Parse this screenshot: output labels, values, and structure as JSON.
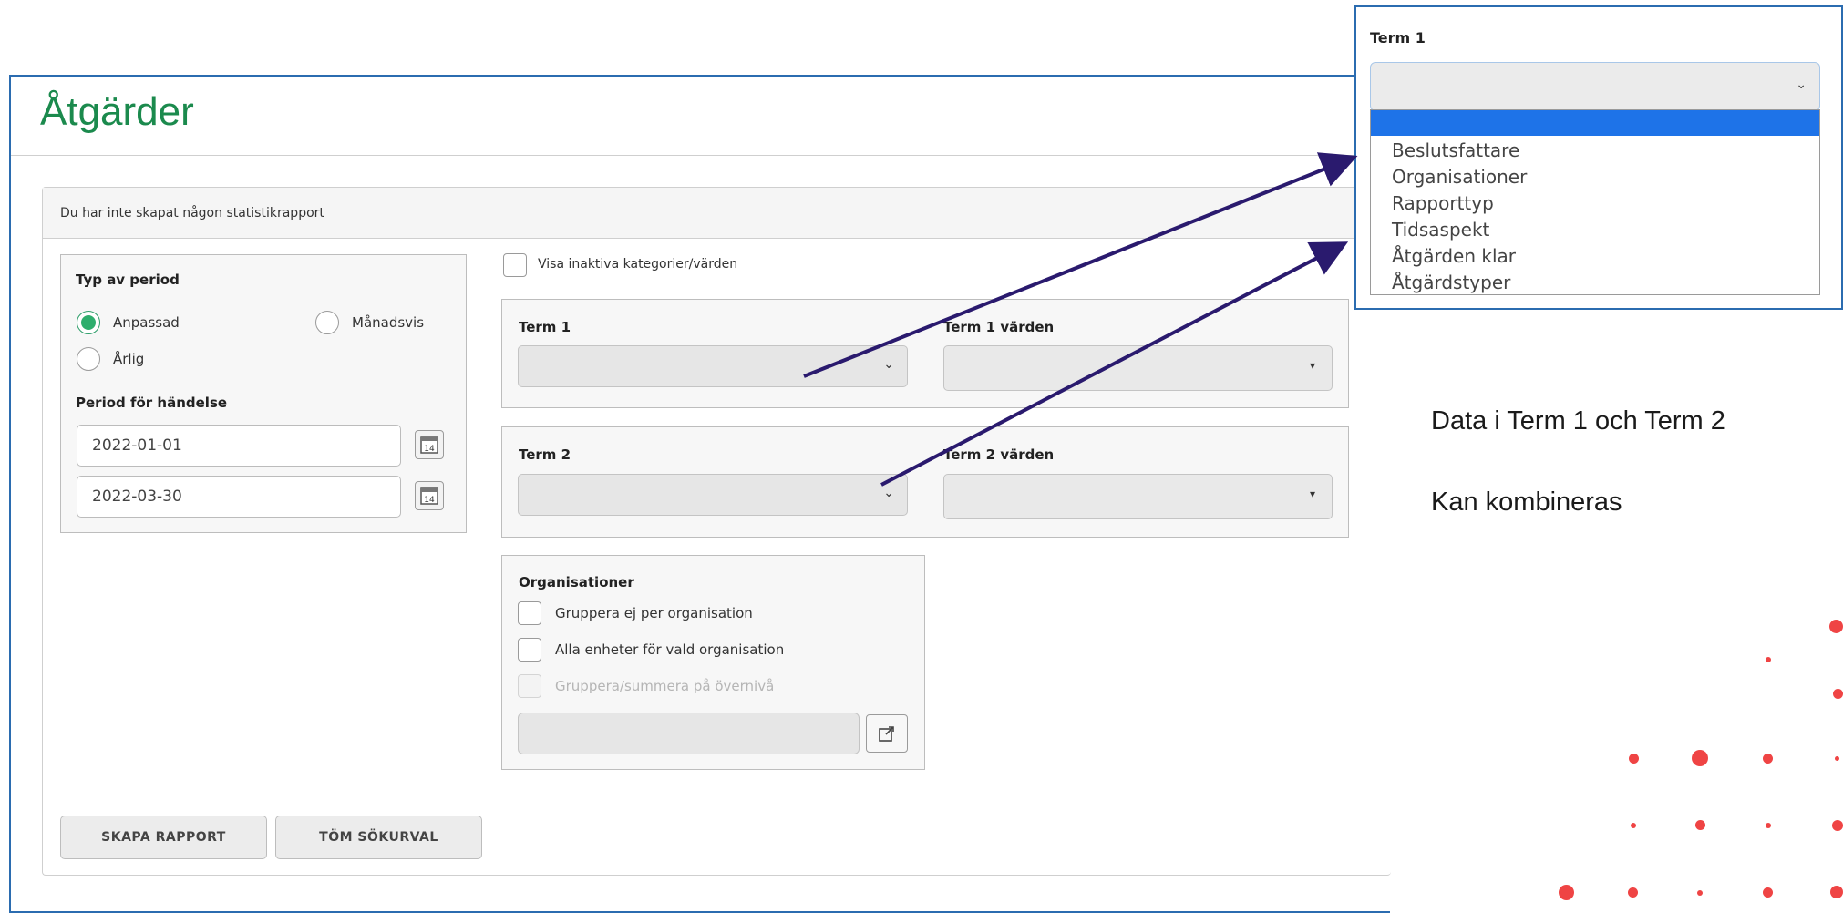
{
  "page": {
    "title": "Åtgärder",
    "message": "Du har inte skapat någon statistikrapport"
  },
  "period": {
    "heading": "Typ av period",
    "options": [
      {
        "label": "Anpassad",
        "selected": true
      },
      {
        "label": "Månadsvis",
        "selected": false
      },
      {
        "label": "Årlig",
        "selected": false
      }
    ],
    "range_heading": "Period för händelse",
    "from_date": "2022-01-01",
    "to_date": "2022-03-30",
    "calendar_day": "14"
  },
  "filters": {
    "show_inactive_label": "Visa inaktiva kategorier/värden",
    "term1_label": "Term 1",
    "term1_values_label": "Term 1 värden",
    "term2_label": "Term 2",
    "term2_values_label": "Term 2 värden"
  },
  "organisations": {
    "heading": "Organisationer",
    "checks": [
      {
        "label": "Gruppera ej per organisation",
        "enabled": true
      },
      {
        "label": "Alla enheter för vald organisation",
        "enabled": true
      },
      {
        "label": "Gruppera/summera på övernivå",
        "enabled": false
      }
    ]
  },
  "actions": {
    "create": "SKAPA RAPPORT",
    "clear": "TÖM SÖKURVAL"
  },
  "dropdown_callout": {
    "label": "Term 1",
    "items": [
      "",
      "Beslutsfattare",
      "Organisationer",
      "Rapporttyp",
      "Tidsaspekt",
      "Åtgärden klar",
      "Åtgärdstyper"
    ]
  },
  "notes": {
    "line1": "Data i Term 1 och Term 2",
    "line2": "Kan kombineras"
  },
  "colors": {
    "accent_green": "#1b8a4d",
    "frame_blue": "#2b6cb0",
    "arrow": "#2a1a6e",
    "highlight": "#1e73e8",
    "dots": "#ef4444"
  }
}
